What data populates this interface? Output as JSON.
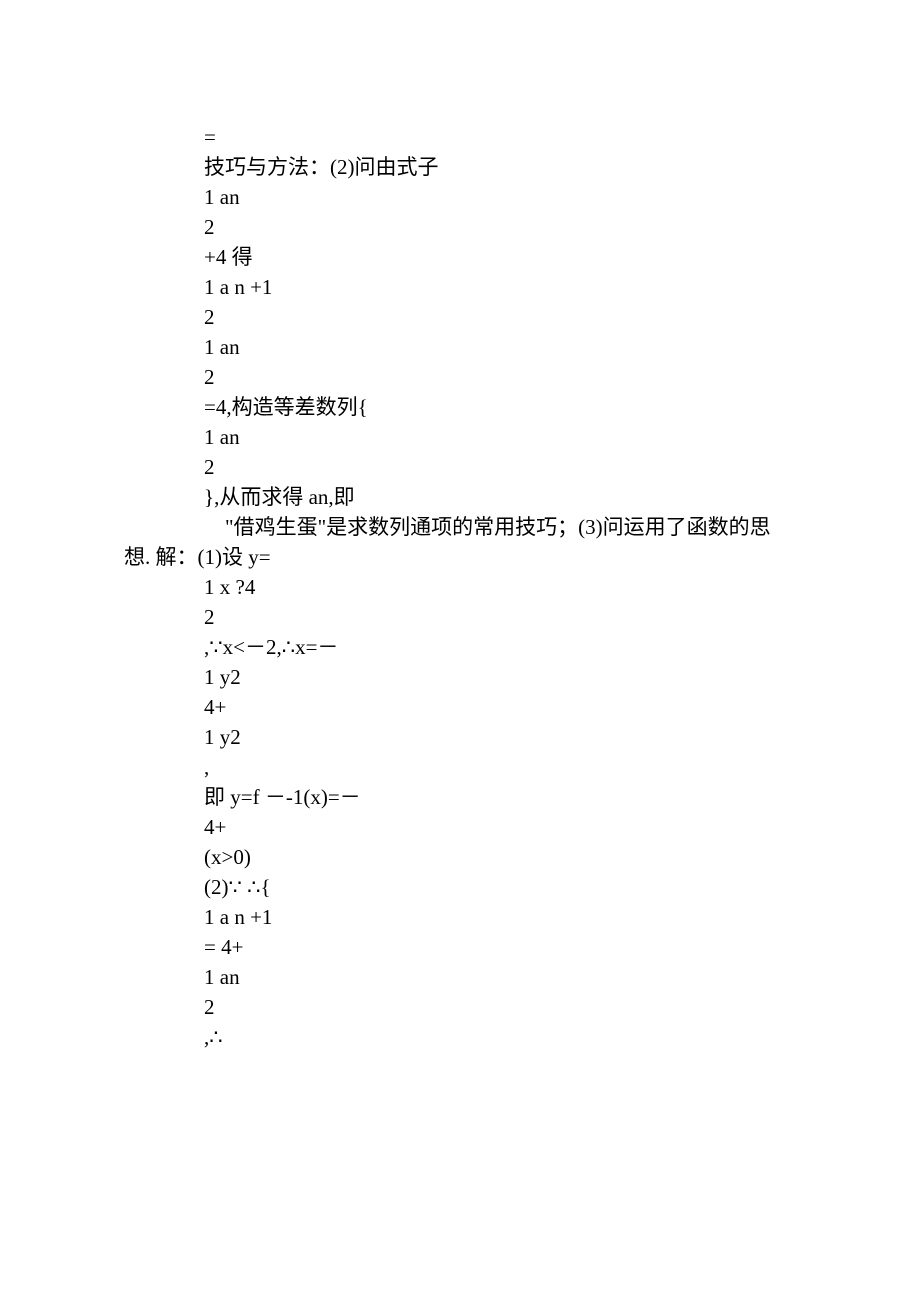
{
  "lines": {
    "l01": "=",
    "l02": "技巧与方法：(2)问由式子",
    "l03": "1 an",
    "l04": "2",
    "l05": "+4 得",
    "l06": "1 a n +1",
    "l07": "2",
    "l08": "1 an",
    "l09": "2",
    "l10": "=4,构造等差数列{",
    "l11": "1 an",
    "l12": "2",
    "l13": "},从而求得 an,即",
    "l14a": "　\"借鸡生蛋\"是求数列通项的常用技巧；(3)问运用了函数的思",
    "l14b": "想. 解：(1)设 y=",
    "l15": "1 x ?4",
    "l16": "2",
    "l17": ",∵x<－2,∴x=－",
    "l18": "1 y2",
    "l19": "4+",
    "l20": "1 y2",
    "l21": ",",
    "l22": "即 y=f －-1(x)=－",
    "l23": "4+",
    "l24": "(x>0)",
    "l25": "(2)∵ ∴{",
    "l26": "1 a n +1",
    "l27": "= 4+",
    "l28": "1 an",
    "l29": "2",
    "l30": ",∴"
  }
}
